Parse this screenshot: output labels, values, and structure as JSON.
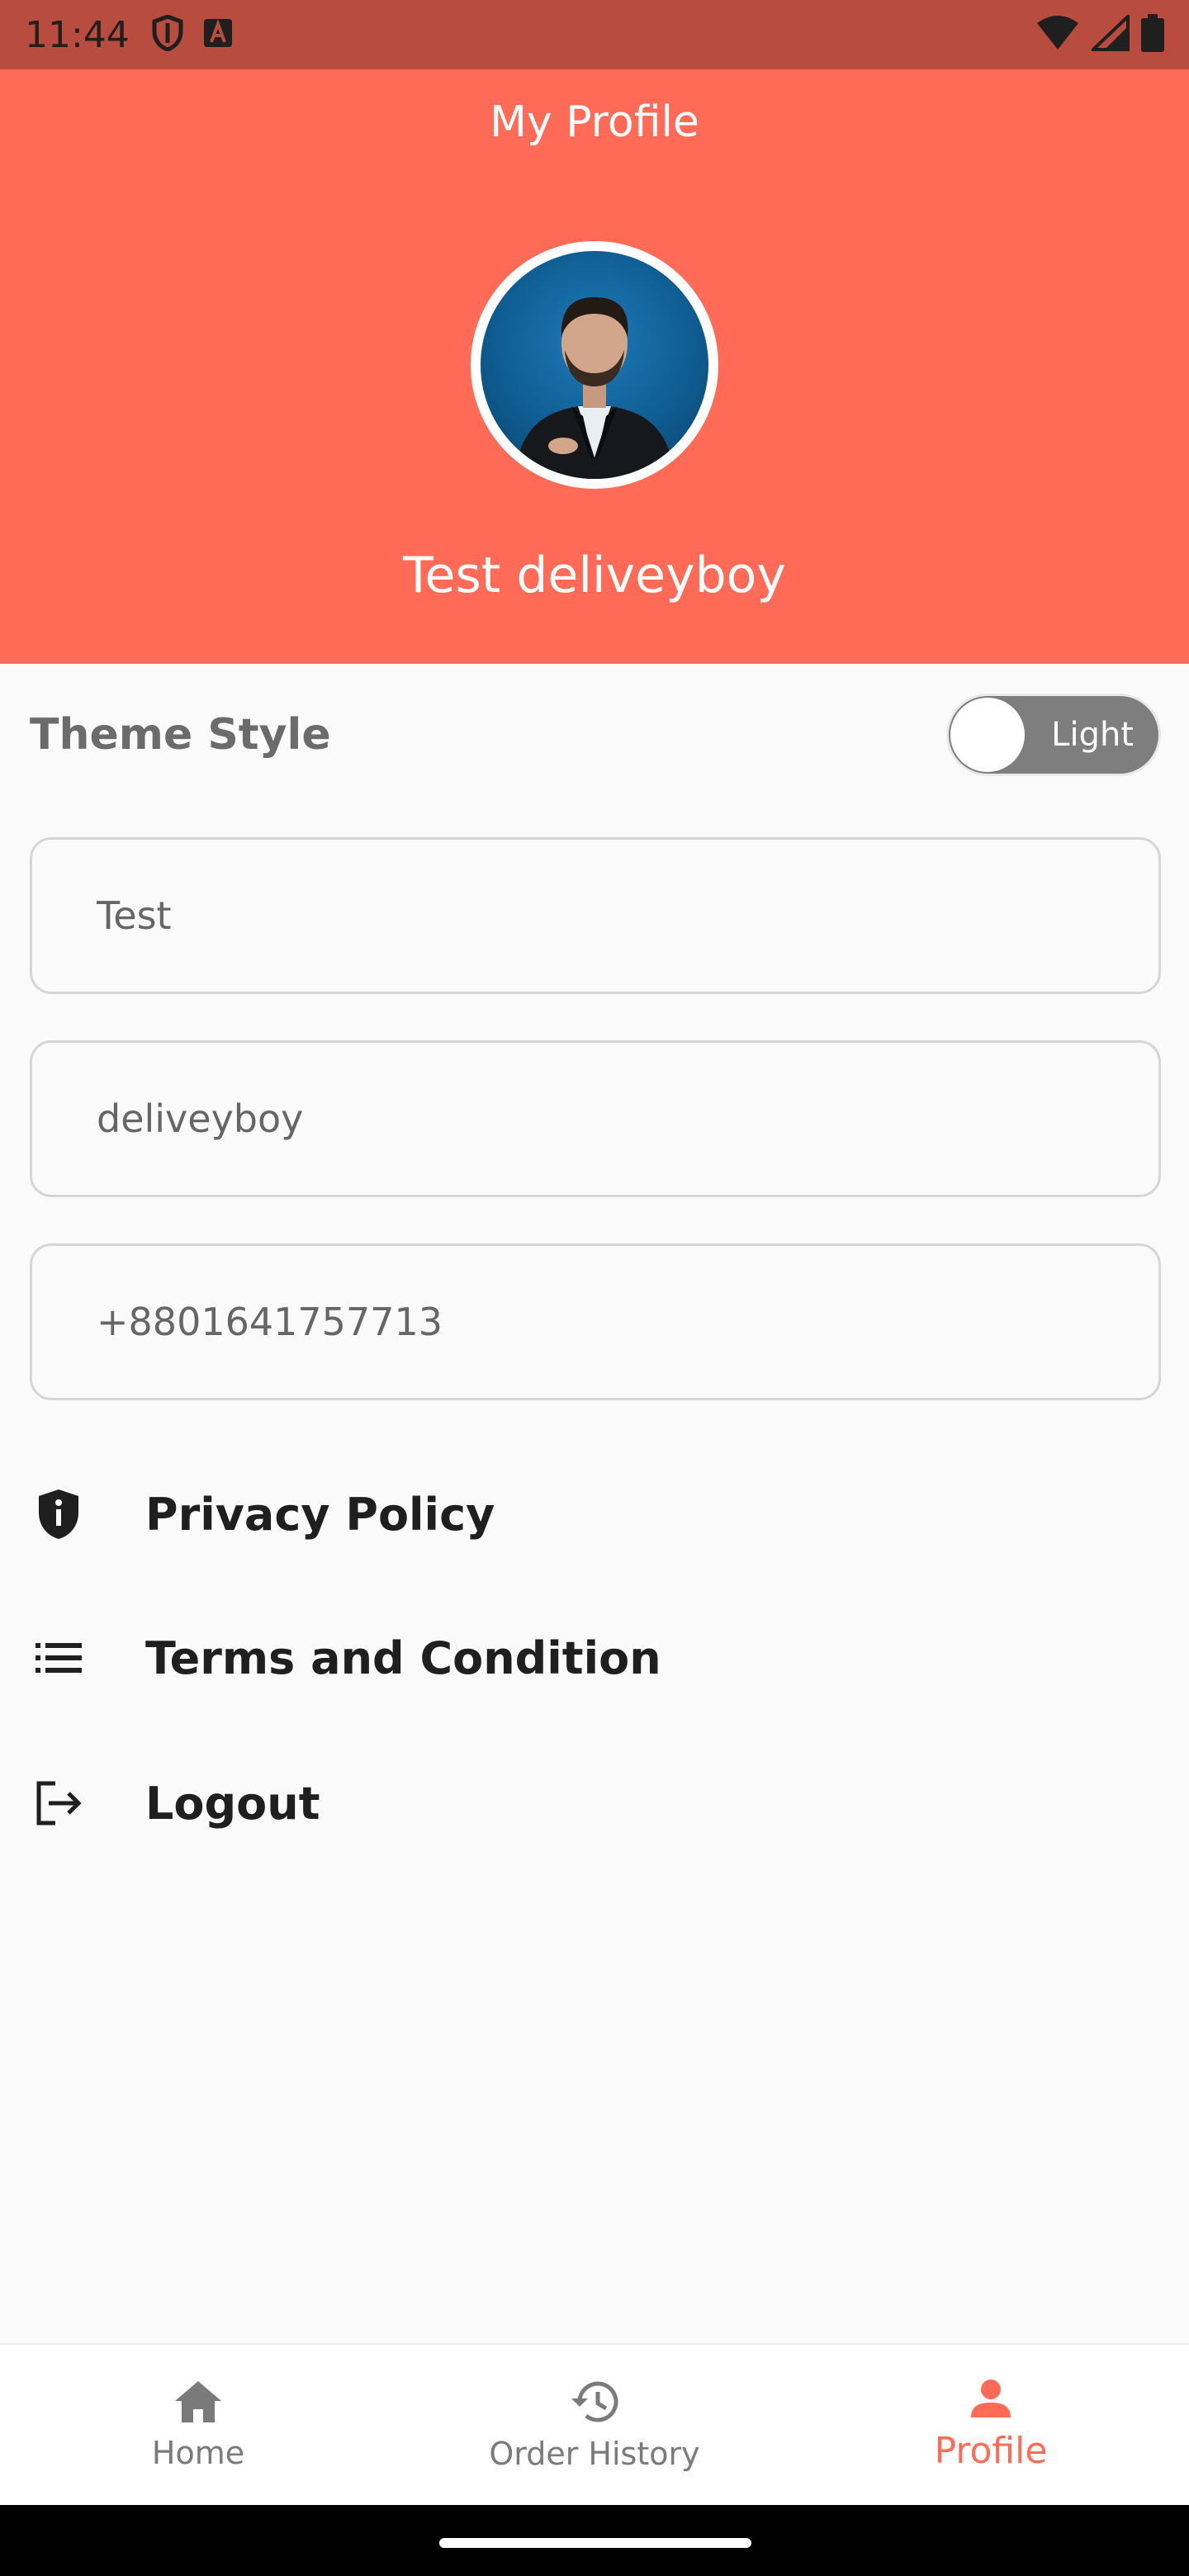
{
  "status_bar": {
    "time": "11:44"
  },
  "header": {
    "title": "My Profile",
    "name": "Test deliveyboy",
    "bg_color": "#ff6b57"
  },
  "theme": {
    "label": "Theme Style",
    "toggle_text": "Light"
  },
  "fields": {
    "first_name": "Test",
    "last_name": "deliveyboy",
    "phone": "+8801641757713"
  },
  "menu": [
    {
      "label": "Privacy Policy",
      "icon": "shield-info-icon"
    },
    {
      "label": "Terms and Condition",
      "icon": "list-icon"
    },
    {
      "label": "Logout",
      "icon": "logout-icon"
    }
  ],
  "bottom_nav": [
    {
      "label": "Home",
      "icon": "home-icon"
    },
    {
      "label": "Order History",
      "icon": "history-icon"
    },
    {
      "label": "Profile",
      "icon": "person-icon",
      "active": true
    }
  ],
  "colors": {
    "accent": "#ff6b57",
    "status_bar": "#b84d3f"
  }
}
